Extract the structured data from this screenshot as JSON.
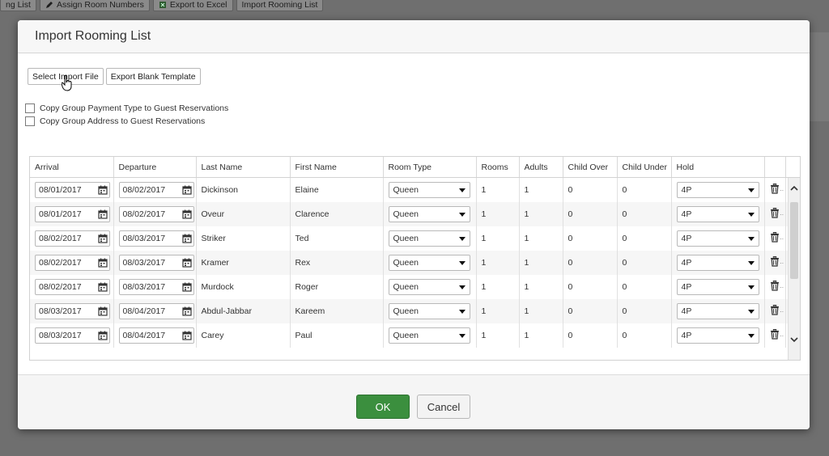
{
  "toolbar": {
    "items": [
      {
        "label": "ng List",
        "icon": "list-icon"
      },
      {
        "label": "Assign Room Numbers",
        "icon": "pencil-icon"
      },
      {
        "label": "Export to Excel",
        "icon": "excel-icon"
      },
      {
        "label": "Import Rooming List",
        "icon": ""
      }
    ]
  },
  "modal": {
    "title": "Import Rooming List",
    "select_file_label": "Select Import File",
    "export_template_label": "Export Blank Template",
    "checkbox_payment_label": "Copy Group Payment Type to Guest Reservations",
    "checkbox_address_label": "Copy Group Address to Guest Reservations",
    "ok_label": "OK",
    "cancel_label": "Cancel",
    "ok_color": "#3b8f3e"
  },
  "table": {
    "headers": [
      "Arrival",
      "Departure",
      "Last Name",
      "First Name",
      "Room Type",
      "Rooms",
      "Adults",
      "Child Over",
      "Child Under",
      "Hold"
    ],
    "rows": [
      {
        "arrival": "08/01/2017",
        "departure": "08/02/2017",
        "last": "Dickinson",
        "first": "Elaine",
        "room_type": "Queen",
        "rooms": "1",
        "adults": "1",
        "child_over": "0",
        "child_under": "0",
        "hold": "4P"
      },
      {
        "arrival": "08/01/2017",
        "departure": "08/02/2017",
        "last": "Oveur",
        "first": "Clarence",
        "room_type": "Queen",
        "rooms": "1",
        "adults": "1",
        "child_over": "0",
        "child_under": "0",
        "hold": "4P"
      },
      {
        "arrival": "08/02/2017",
        "departure": "08/03/2017",
        "last": "Striker",
        "first": "Ted",
        "room_type": "Queen",
        "rooms": "1",
        "adults": "1",
        "child_over": "0",
        "child_under": "0",
        "hold": "4P"
      },
      {
        "arrival": "08/02/2017",
        "departure": "08/03/2017",
        "last": "Kramer",
        "first": "Rex",
        "room_type": "Queen",
        "rooms": "1",
        "adults": "1",
        "child_over": "0",
        "child_under": "0",
        "hold": "4P"
      },
      {
        "arrival": "08/02/2017",
        "departure": "08/03/2017",
        "last": "Murdock",
        "first": "Roger",
        "room_type": "Queen",
        "rooms": "1",
        "adults": "1",
        "child_over": "0",
        "child_under": "0",
        "hold": "4P"
      },
      {
        "arrival": "08/03/2017",
        "departure": "08/04/2017",
        "last": "Abdul-Jabbar",
        "first": "Kareem",
        "room_type": "Queen",
        "rooms": "1",
        "adults": "1",
        "child_over": "0",
        "child_under": "0",
        "hold": "4P"
      },
      {
        "arrival": "08/03/2017",
        "departure": "08/04/2017",
        "last": "Carey",
        "first": "Paul",
        "room_type": "Queen",
        "rooms": "1",
        "adults": "1",
        "child_over": "0",
        "child_under": "0",
        "hold": "4P"
      }
    ]
  }
}
